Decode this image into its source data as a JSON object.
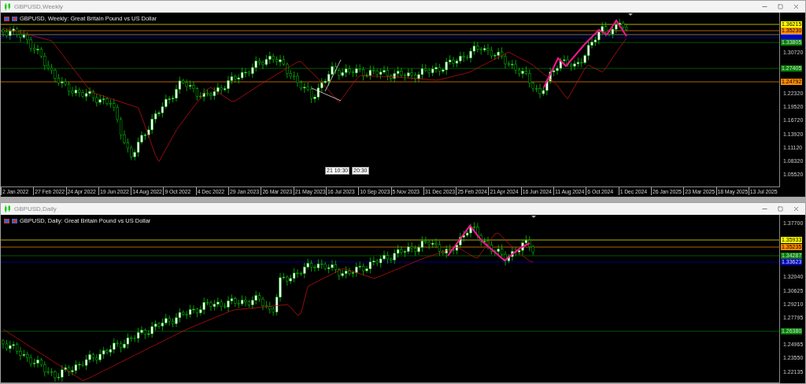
{
  "windows": [
    {
      "title": "GBPUSD,Weekly",
      "chart_label": "GBPUSD, Weekly:  Great Britain Pound vs US Dollar",
      "price_ticks": [
        "1.30720",
        "1.22320",
        "1.19520",
        "1.16720",
        "1.13920",
        "1.11120",
        "1.08320",
        "1.05520"
      ],
      "price_tags": [
        {
          "text": "1.36215",
          "color": "#ffff00"
        },
        {
          "text": "1.35230",
          "color": "#ff8c00"
        },
        {
          "color": "#a0a0a0"
        },
        {
          "color": "#0000c8"
        },
        {
          "text": "1.33805",
          "color": "#008000"
        },
        {
          "text": "1.27405",
          "color": "#008000"
        },
        {
          "text": "1.24792",
          "color": "#ff8c00"
        }
      ],
      "crosshair_labels": [
        "21 10:30",
        "20:30"
      ],
      "time_labels": [
        "2 Jan 2022",
        "27 Feb 2022",
        "24 Apr 2022",
        "19 Jun 2022",
        "14 Aug 2022",
        "9 Oct 2022",
        "4 Dec 2022",
        "29 Jan 2023",
        "26 Mar 2023",
        "21 May 2023",
        "16 Jul 2023",
        "10 Sep 2023",
        "5 Nov 2023",
        "31 Dec 2023",
        "25 Feb 2024",
        "21 Apr 2024",
        "16 Jun 2024",
        "11 Aug 2024",
        "6 Oct 2024",
        "1 Dec 2024",
        "26 Jan 2025",
        "23 Mar 2025",
        "18 May 2025",
        "13 Jul 2025"
      ]
    },
    {
      "title": "GBPUSD,Daily",
      "chart_label": "GBPUSD, Daily:  Great Britain Pound vs US Dollar",
      "price_ticks": [
        "1.37700",
        "1.32040",
        "1.30625",
        "1.29210",
        "1.27795",
        "1.24965",
        "1.23550",
        "1.22135"
      ],
      "price_tags": [
        {
          "text": "1.35933",
          "color": "#ffff00"
        },
        {
          "text": "1.35235",
          "color": "#ff8c00"
        },
        {
          "text": "1.34287",
          "color": "#008000"
        },
        {
          "text": "1.33623",
          "color": "#0000c8"
        },
        {
          "text": "1.26380",
          "color": "#008000"
        }
      ]
    }
  ]
}
